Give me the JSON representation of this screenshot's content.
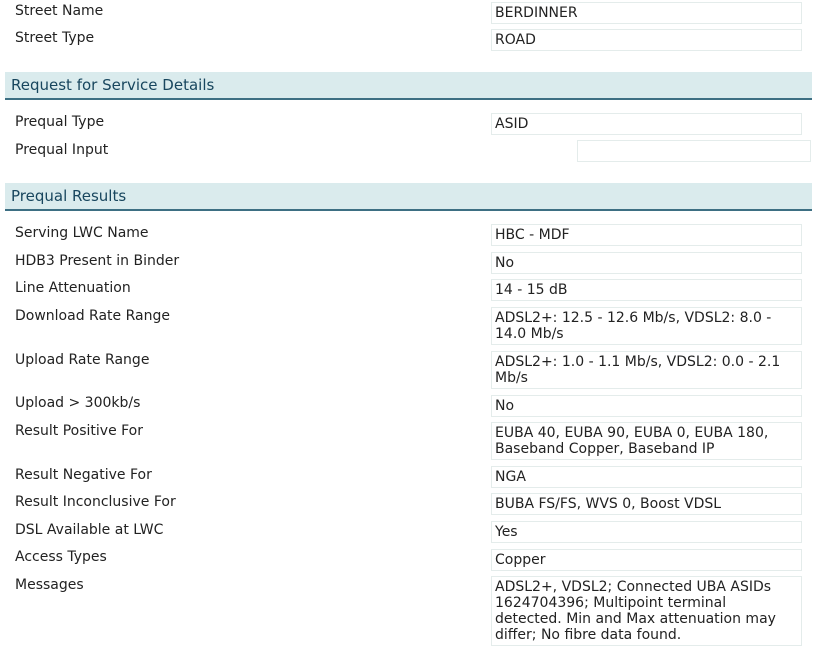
{
  "address": {
    "street_name_label": "Street Name",
    "street_name_value": "BERDINNER",
    "street_type_label": "Street Type",
    "street_type_value": "ROAD"
  },
  "request_section": {
    "title": "Request for Service Details",
    "prequal_type_label": "Prequal Type",
    "prequal_type_value": "ASID",
    "prequal_input_label": "Prequal Input",
    "prequal_input_value": ""
  },
  "results_section": {
    "title": "Prequal Results",
    "rows": [
      {
        "label": "Serving LWC Name",
        "value": "HBC - MDF"
      },
      {
        "label": "HDB3 Present in Binder",
        "value": "No"
      },
      {
        "label": "Line Attenuation",
        "value": "14 - 15 dB"
      },
      {
        "label": "Download Rate Range",
        "value": "ADSL2+: 12.5 - 12.6 Mb/s, VDSL2: 8.0 - 14.0 Mb/s"
      },
      {
        "label": "Upload Rate Range",
        "value": "ADSL2+: 1.0 - 1.1 Mb/s, VDSL2: 0.0 - 2.1 Mb/s"
      },
      {
        "label": "Upload > 300kb/s",
        "value": "No"
      },
      {
        "label": "Result Positive For",
        "value": "EUBA 40, EUBA 90, EUBA 0, EUBA 180, Baseband Copper, Baseband IP"
      },
      {
        "label": "Result Negative For",
        "value": "NGA"
      },
      {
        "label": "Result Inconclusive For",
        "value": "BUBA FS/FS, WVS 0, Boost VDSL"
      },
      {
        "label": "DSL Available at LWC",
        "value": "Yes"
      },
      {
        "label": "Access Types",
        "value": "Copper"
      },
      {
        "label": "Messages",
        "value": "ADSL2+, VDSL2; Connected UBA ASIDs 1624704396; Multipoint terminal detected. Min and Max attenuation may differ; No fibre data found."
      }
    ]
  }
}
